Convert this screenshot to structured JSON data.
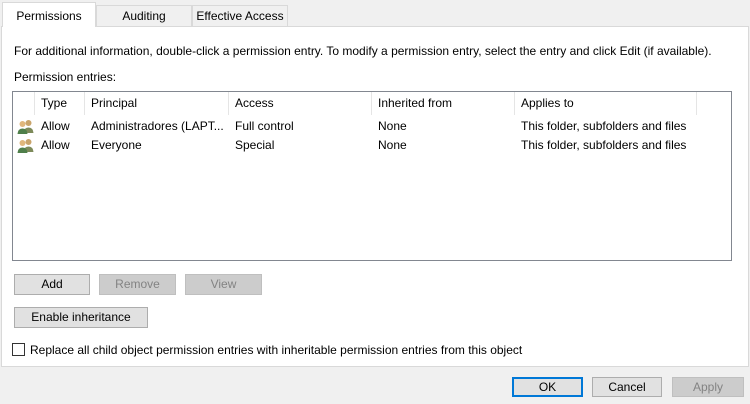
{
  "tabs": [
    {
      "label": "Permissions",
      "active": true
    },
    {
      "label": "Auditing",
      "active": false
    },
    {
      "label": "Effective Access",
      "active": false
    }
  ],
  "info_text": "For additional information, double-click a permission entry. To modify a permission entry, select the entry and click Edit (if available).",
  "entries_label": "Permission entries:",
  "columns": {
    "type": "Type",
    "principal": "Principal",
    "access": "Access",
    "inherited_from": "Inherited from",
    "applies_to": "Applies to"
  },
  "entries": [
    {
      "icon": "user-group-icon",
      "type": "Allow",
      "principal": "Administradores (LAPT...",
      "access": "Full control",
      "inherited_from": "None",
      "applies_to": "This folder, subfolders and files"
    },
    {
      "icon": "user-group-icon",
      "type": "Allow",
      "principal": "Everyone",
      "access": "Special",
      "inherited_from": "None",
      "applies_to": "This folder, subfolders and files"
    }
  ],
  "buttons": {
    "add": "Add",
    "remove": "Remove",
    "view": "View",
    "enable_inheritance": "Enable inheritance",
    "ok": "OK",
    "cancel": "Cancel",
    "apply": "Apply"
  },
  "replace_checkbox": {
    "label": "Replace all child object permission entries with inheritable permission entries from this object",
    "checked": false
  },
  "colors": {
    "default_button_border": "#0078d7",
    "disabled_text": "#838383"
  }
}
